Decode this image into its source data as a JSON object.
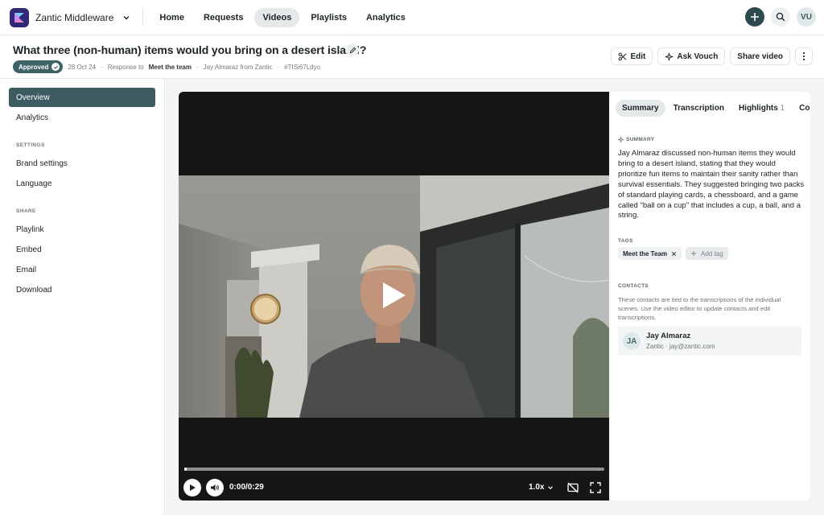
{
  "topnav": {
    "workspace": "Zantic Middleware",
    "items": [
      {
        "label": "Home",
        "active": false
      },
      {
        "label": "Requests",
        "active": false
      },
      {
        "label": "Videos",
        "active": true
      },
      {
        "label": "Playlists",
        "active": false
      },
      {
        "label": "Analytics",
        "active": false
      }
    ],
    "user_initials": "VU",
    "icons": [
      "plus-icon",
      "search-icon",
      "chevron-down-icon"
    ]
  },
  "header": {
    "title": "What three (non-human) items would you bring on a desert island?",
    "status": "Approved",
    "date": "28 Oct 24",
    "response_to_prefix": "Response to",
    "response_to": "Meet the team",
    "author": "Jay Almaraz from Zantic",
    "code": "#TISi67Ldyo",
    "actions": {
      "edit": "Edit",
      "ask": "Ask Vouch",
      "share": "Share video"
    }
  },
  "sidebar": {
    "items": [
      {
        "label": "Overview",
        "active": true
      },
      {
        "label": "Analytics",
        "active": false
      }
    ],
    "settings_heading": "SETTINGS",
    "settings": [
      {
        "label": "Brand settings"
      },
      {
        "label": "Language"
      }
    ],
    "share_heading": "SHARE",
    "share": [
      {
        "label": "Playlink"
      },
      {
        "label": "Embed"
      },
      {
        "label": "Email"
      },
      {
        "label": "Download"
      }
    ]
  },
  "player": {
    "time": "0:00/0:29",
    "speed": "1.0x",
    "progress": 0.0
  },
  "panel": {
    "tabs": [
      {
        "label": "Summary",
        "active": true
      },
      {
        "label": "Transcription",
        "active": false
      },
      {
        "label": "Highlights",
        "count": "1",
        "active": false
      },
      {
        "label": "Comments",
        "active": false
      }
    ],
    "summary_heading": "SUMMARY",
    "summary": "Jay Almaraz discussed non-human items they would bring to a desert island, stating that they would prioritize fun items to maintain their sanity rather than survival essentials. They suggested bringing two packs of standard playing cards, a chessboard, and a game called \"ball on a cup\" that includes a cup, a ball, and a string.",
    "tags_heading": "TAGS",
    "tags": [
      "Meet the Team"
    ],
    "add_tag": "Add tag",
    "contacts_heading": "CONTACTS",
    "contacts_note": "These contacts are tied to the transcriptions of the individual scenes. Use the video editor to update contacts and edit transcriptions.",
    "contact": {
      "initials": "JA",
      "name": "Jay Almaraz",
      "company": "Zantic",
      "email": "jay@zantic.com"
    }
  },
  "colors": {
    "accent": "#3d5c61",
    "brand": "#2e2a78"
  }
}
